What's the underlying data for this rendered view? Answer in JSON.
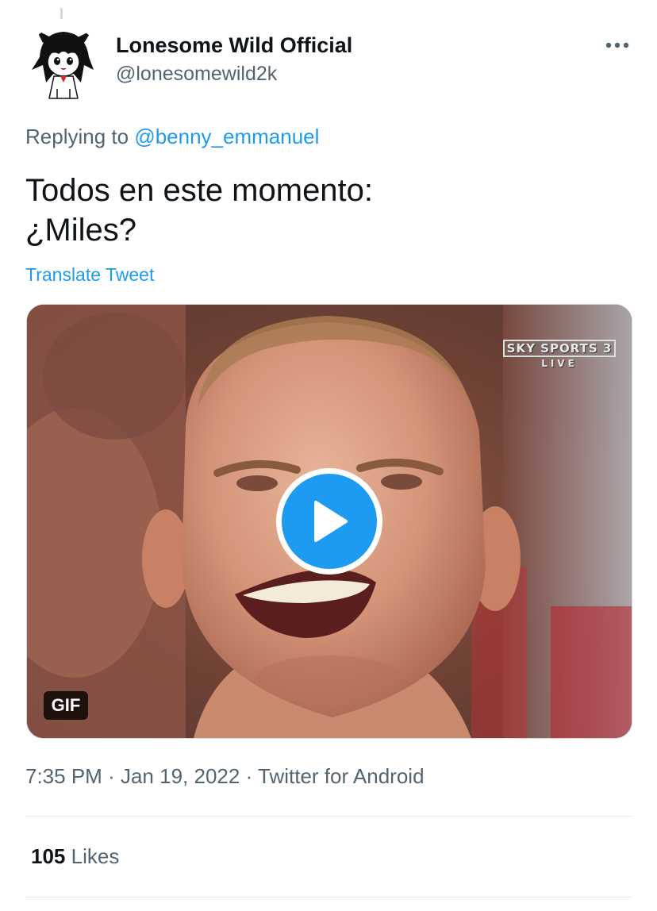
{
  "tweet": {
    "author": {
      "display_name": "Lonesome Wild Official",
      "handle": "@lonesomewild2k"
    },
    "reply_prefix": "Replying to",
    "reply_to": "@benny_emmanuel",
    "text_line1": "Todos en este momento:",
    "text_line2": "¿Miles?",
    "translate_label": "Translate Tweet",
    "media": {
      "badge": "GIF",
      "watermark_line1": "SKY SPORTS 3",
      "watermark_line2": "LIVE"
    },
    "time": "7:35 PM",
    "date": "Jan 19, 2022",
    "separator": "·",
    "source": "Twitter for Android",
    "likes_count": "105",
    "likes_label": "Likes"
  },
  "colors": {
    "accent": "#1d9bf0",
    "text_primary": "#0f1419",
    "text_secondary": "#536471",
    "divider": "#e4e9ec"
  },
  "icons": {
    "more": "more-dots-icon",
    "play": "play-icon"
  }
}
